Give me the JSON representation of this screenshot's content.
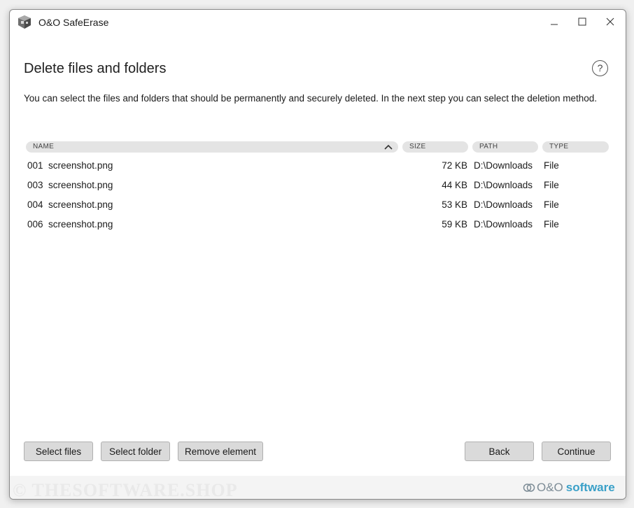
{
  "window": {
    "title": "O&O SafeErase"
  },
  "page": {
    "heading": "Delete files and folders",
    "help_label": "?",
    "description": "You can select the files and folders that should be permanently and securely deleted. In the next step you can select the deletion method."
  },
  "table": {
    "columns": [
      "NAME",
      "SIZE",
      "PATH",
      "TYPE"
    ],
    "sort_column": "NAME",
    "sort_direction": "ascending",
    "rows": [
      {
        "name": "001  screenshot.png",
        "size": "72 KB",
        "path": "D:\\Downloads",
        "type": "File"
      },
      {
        "name": "003  screenshot.png",
        "size": "44 KB",
        "path": "D:\\Downloads",
        "type": "File"
      },
      {
        "name": "004  screenshot.png",
        "size": "53 KB",
        "path": "D:\\Downloads",
        "type": "File"
      },
      {
        "name": "006  screenshot.png",
        "size": "59 KB",
        "path": "D:\\Downloads",
        "type": "File"
      }
    ]
  },
  "buttons": {
    "select_files": "Select files",
    "select_folder": "Select folder",
    "remove_element": "Remove element",
    "back": "Back",
    "continue": "Continue"
  },
  "footer": {
    "watermark": "© THESOFTWARE.SHOP",
    "brand_prefix": "O&O",
    "brand_suffix": "software"
  },
  "colors": {
    "brand_blue": "#3aa0c8",
    "brand_gray": "#7d8c96",
    "header_pill": "#e4e4e4",
    "button_bg": "#dadada"
  },
  "icons": {
    "app": "safeerase-app-icon",
    "minimize": "minimize-icon",
    "maximize": "maximize-icon",
    "close": "close-icon",
    "help": "help-icon",
    "sort": "chevron-up-icon",
    "brand": "oo-logo-icon"
  }
}
